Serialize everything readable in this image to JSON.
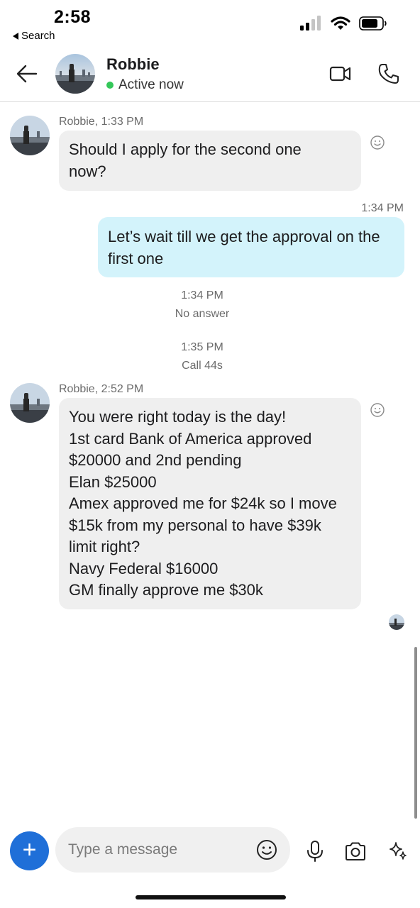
{
  "status_bar": {
    "time": "2:58",
    "back_label": "Search"
  },
  "header": {
    "name": "Robbie",
    "presence": "Active now",
    "presence_color": "#34c759"
  },
  "messages": [
    {
      "sender_line": "Robbie, 1:33 PM",
      "lines": [
        "Should I apply for the second one",
        "now?"
      ]
    },
    {
      "time": "1:34 PM",
      "lines": [
        "Let’s wait till we get the approval on the",
        "first one"
      ]
    },
    {
      "time": "1:34 PM",
      "status": "No answer"
    },
    {
      "time": "1:35 PM",
      "status": "Call 44s"
    },
    {
      "sender_line": "Robbie, 2:52 PM",
      "lines": [
        "You were right today is the day!",
        "1st card Bank of America approved",
        "$20000 and 2nd pending",
        "Elan $25000",
        "Amex approved me for $24k so I move",
        "$15k from my personal to have $39k",
        "limit right?",
        "Navy Federal $16000",
        "GM finally approve me $30k"
      ]
    }
  ],
  "composer": {
    "placeholder": "Type a message"
  },
  "colors": {
    "accent": "#1f6fd8",
    "outgoing_bubble": "#d3f3fb",
    "incoming_bubble": "#efefef"
  },
  "icons": {
    "back": "arrow-left-icon",
    "video": "video-camera-icon",
    "call": "phone-icon",
    "react": "smiley-icon",
    "plus": "plus-icon",
    "emoji": "emoji-icon",
    "mic": "microphone-icon",
    "camera": "camera-icon",
    "sparkle": "sparkle-icon"
  }
}
